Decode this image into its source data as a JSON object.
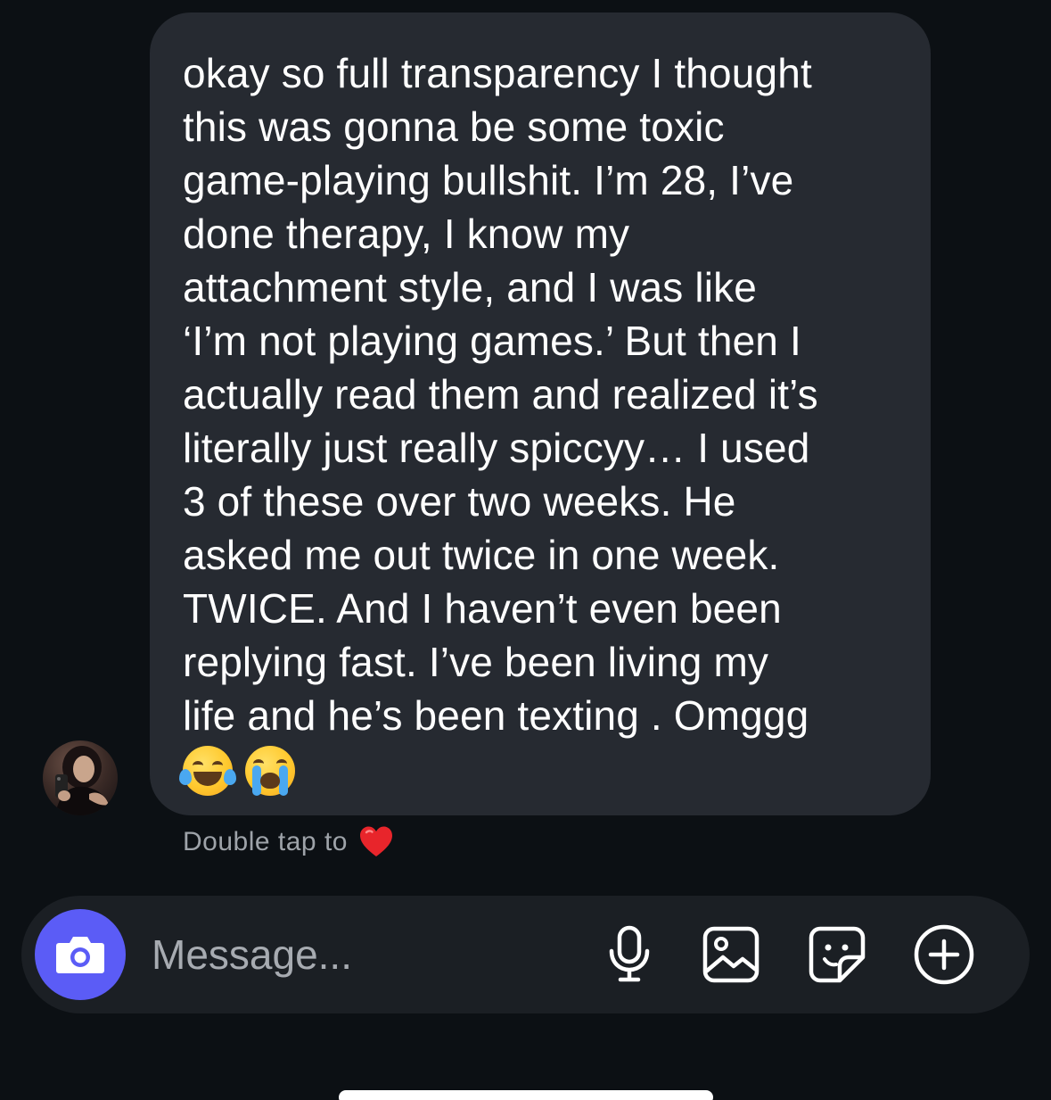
{
  "message": {
    "text": "okay so full transparency I thought\nthis was gonna be some toxic\ngame-playing bullshit. I’m 28, I’ve\ndone therapy, I know my\nattachment style, and I was like\n‘I’m not playing games.’ But then I\nactually read them and realized it’s\nliterally just really spiccyy… I used\n3 of these over two weeks. He\nasked me out twice in one week.\nTWICE. And I haven’t even been\nreplying fast. I’ve been living my\nlife and he’s been texting . Omggg",
    "emojis": [
      "face-with-tears-of-joy",
      "loudly-crying-face"
    ]
  },
  "hint": {
    "label": "Double tap to",
    "icon": "red-heart-icon"
  },
  "composer": {
    "placeholder": "Message...",
    "value": "",
    "icons": {
      "camera": "camera-icon",
      "microphone": "microphone-icon",
      "gallery": "image-icon",
      "sticker": "sticker-icon",
      "more": "plus-circle-icon"
    }
  },
  "colors": {
    "background": "#0c1014",
    "bubble": "#262a31",
    "composer": "#1b1f24",
    "camera_accent": "#5b5cf6",
    "heart": "#e8252b",
    "hint_text": "#9ea3a9"
  }
}
